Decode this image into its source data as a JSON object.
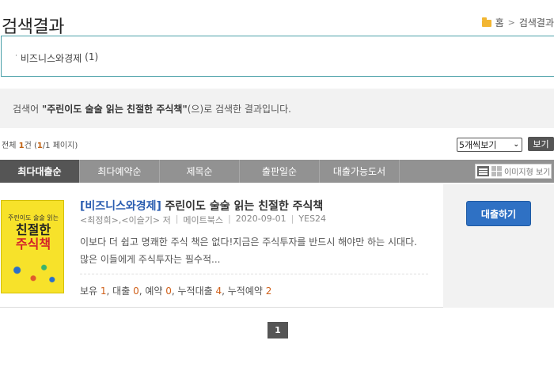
{
  "page": {
    "title": "검색결과"
  },
  "breadcrumb": {
    "home": "홈",
    "separator": ">",
    "current": "검색결과"
  },
  "facets": [
    {
      "label": "비즈니스와경제",
      "count": "(1)"
    }
  ],
  "search_summary": {
    "prefix": "검색어 ",
    "term": "\"주린이도 술술 읽는 친절한 주식책\"",
    "suffix": "(으)로 검색한 결과입니다."
  },
  "result_count": {
    "label": "전체 ",
    "total": "1",
    "unit": "건 (",
    "current_page": "1",
    "page_total": "/1 페이지)"
  },
  "view_options": {
    "selected": "5개씩보기",
    "button": "보기"
  },
  "sort_tabs": [
    {
      "label": "최다대출순",
      "active": true
    },
    {
      "label": "최다예약순",
      "active": false
    },
    {
      "label": "제목순",
      "active": false
    },
    {
      "label": "출판일순",
      "active": false
    },
    {
      "label": "대출가능도서",
      "active": false
    }
  ],
  "view_toggle": {
    "label": "이미지형 보기"
  },
  "results": [
    {
      "category": "[비즈니스와경제]",
      "title": "주린이도 술술 읽는 친절한 주식책",
      "authors": "<최정희>,<이슬기> 저",
      "publisher": "메이트북스",
      "date": "2020-09-01",
      "provider": "YES24",
      "description": "이보다 더 쉽고 명쾌한 주식 책은 없다!지금은 주식투자를 반드시 해야만 하는 시대다. 많은 이들에게 주식투자는 필수적...",
      "stats": {
        "holding_label": "보유 ",
        "holding": "1",
        "loan_label": ", 대출 ",
        "loan": "0",
        "reserve_label": ", 예약 ",
        "reserve": "0",
        "cum_loan_label": ", 누적대출 ",
        "cum_loan": "4",
        "cum_reserve_label": ", 누적예약 ",
        "cum_reserve": "2"
      },
      "action": "대출하기",
      "cover": {
        "top_text": "주린이도 술술 읽는",
        "title_line1": "친절한",
        "title_line2": "주식책"
      }
    }
  ],
  "pagination": {
    "current": "1"
  },
  "colors": {
    "accent": "#2f71c4",
    "sort_bar": "#929292",
    "sort_active": "#555555",
    "highlight": "#d0601a",
    "facet_border": "#4aa0a8"
  }
}
